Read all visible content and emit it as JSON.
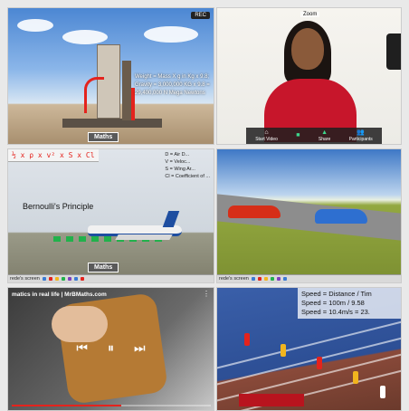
{
  "tiles": {
    "rocket": {
      "record_badge": "REC",
      "forces_text": "Weight = Mass X g in Kg x 9.8; Gravity = 3,000,000 KG x 9.8 = 29,400,000 N Mega Newtons",
      "topic_badge": "Maths"
    },
    "speaker": {
      "name": "Zoom",
      "controls": [
        {
          "icon": "⌂",
          "label": "Start Video"
        },
        {
          "icon": "■",
          "label": ""
        },
        {
          "icon": "▲",
          "label": "Share"
        },
        {
          "icon": "👥",
          "label": "Participants"
        }
      ]
    },
    "airplane": {
      "formula": "½ x ρ x v² x S x Cl",
      "legend": [
        "D = Air D...",
        "V = Veloc...",
        "S = Wing Ar...",
        "Cl = Coefficient of ..."
      ],
      "topic": "Bernoulli's Principle",
      "topic_badge": "Maths",
      "taskbar_label": "rede's screen"
    },
    "cars": {
      "taskbar_label": "rede's screen"
    },
    "video": {
      "title": "matics in real life | MrBMaths.com",
      "progress_pct": 0.55
    },
    "race": {
      "speed_lines": [
        "Speed = Distance / Tim",
        "Speed = 100m / 9.58",
        "Speed = 10.4m/s = 23."
      ]
    }
  },
  "colors": {
    "accent_red": "#e4231d",
    "zoom_green": "#3dd68c"
  }
}
